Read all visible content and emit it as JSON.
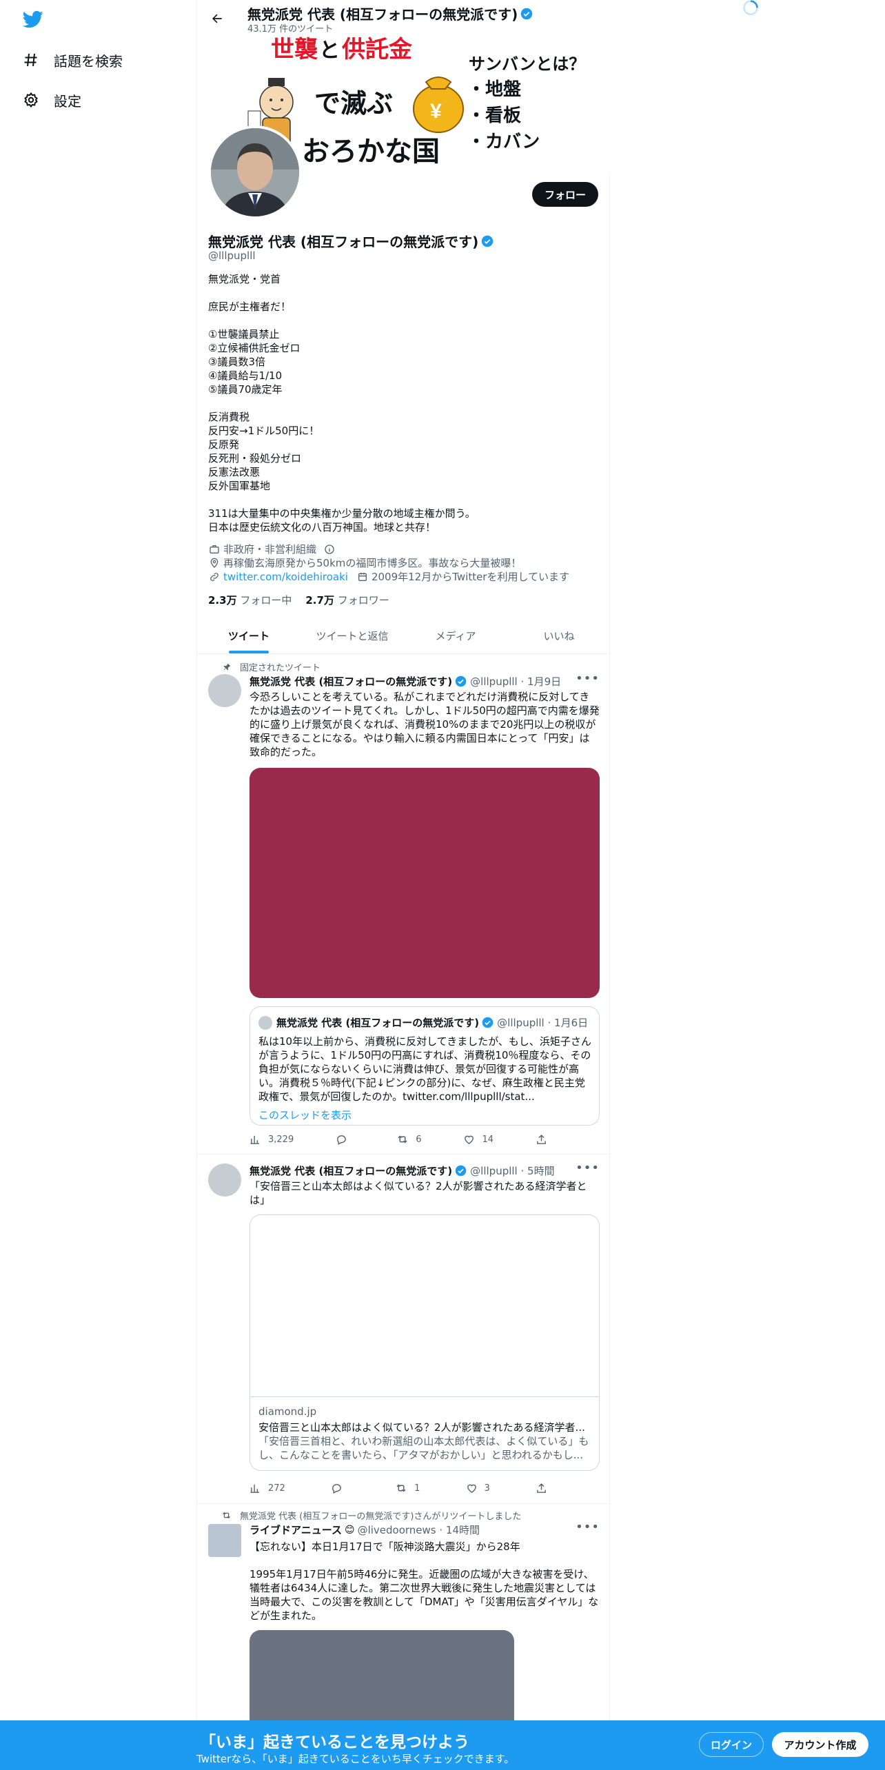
{
  "nav": {
    "items": [
      {
        "label": "話題を検索",
        "icon": "hashtag-icon"
      },
      {
        "label": "設定",
        "icon": "gear-icon"
      }
    ]
  },
  "header": {
    "title": "無党派党 代表 (相互フォローの無党派です)",
    "subtitle": "43.1万 件のツイート"
  },
  "banner": {
    "line1a": "世襲",
    "line1b": "と",
    "line1c": "供託金",
    "line2": "で滅ぶ",
    "line3": "おろかな国",
    "right_title": "サンバンとは？",
    "right_items": [
      "・地盤",
      "・看板",
      "・カバン"
    ],
    "yen": "¥"
  },
  "profile": {
    "follow_label": "フォロー",
    "name": "無党派党 代表 (相互フォローの無党派です)",
    "handle": "@lllpuplll",
    "bio": [
      "無党派党・党首",
      "",
      "庶民が主権者だ！",
      "",
      "①世襲議員禁止",
      "②立候補供託金ゼロ",
      "③議員数3倍",
      "④議員給与1/10",
      "⑤議員70歳定年",
      "",
      "反消費税",
      "反円安→1ドル50円に！",
      "反原発",
      "反死刑・殺処分ゼロ",
      "反憲法改悪",
      "反外国軍基地",
      "",
      "311は大量集中の中央集権か少量分散の地域主権か問う。",
      "日本は歴史伝統文化の八百万神国。地球と共存！"
    ],
    "category": "非政府・非営利組織",
    "location": "再稼働玄海原発から50kmの福岡市博多区。事故なら大量被曝！",
    "website": "twitter.com/koidehiroaki",
    "joined": "2009年12月からTwitterを利用しています",
    "following_count": "2.3万",
    "following_label": "フォロー中",
    "followers_count": "2.7万",
    "followers_label": "フォロワー"
  },
  "tabs": [
    "ツイート",
    "ツイートと返信",
    "メディア",
    "いいね"
  ],
  "tweets": [
    {
      "context": "固定されたツイート",
      "name": "無党派党 代表 (相互フォローの無党派です)",
      "handle": "@lllpuplll",
      "time": "1月9日",
      "text": "今恐ろしいことを考えている。私がこれまでどれだけ消費税に反対してきたかは過去のツイート見てくれ。しかし、1ドル50円の超円高で内需を爆発的に盛り上げ景気が良くなれば、消費税10%のままで20兆円以上の税収が確保できることになる。やはり輸入に頼る内需国日本にとって「円安」は致命的だった。",
      "media_color": "#992a4b",
      "quote": {
        "name": "無党派党 代表 (相互フォローの無党派です)",
        "handle": "@lllpuplll",
        "time": "1月6日",
        "text": "私は10年以上前から、消費税に反対してきましたが、もし、浜矩子さんが言うように、1ドル50円の円高にすれば、消費税10％程度なら、その負担が気にならないくらいに消費は伸び、景気が回復する可能性が高い。消費税５％時代(下記↓ピンクの部分)に、なぜ、麻生政権と民主党政権で、景気が回復したのか。twitter.com/lllpuplll/stat...",
        "thread": "このスレッドを表示"
      },
      "views": "3,229",
      "replies": "",
      "retweets": "6",
      "likes": "14"
    },
    {
      "context": "",
      "name": "無党派党 代表 (相互フォローの無党派です)",
      "handle": "@lllpuplll",
      "time": "5時間",
      "text": "「安倍晋三と山本太郎はよく似ている？2人が影響されたある経済学者とは」",
      "card": {
        "domain": "diamond.jp",
        "title": "安倍晋三と山本太郎はよく似ている？2人が影響されたある経済学者...",
        "desc": "「安倍晋三首相と、れいわ新選組の山本太郎代表は、よく似ている」もし、こんなことを書いたら、「アタマがおかしい」と思われるかもし..."
      },
      "views": "272",
      "replies": "",
      "retweets": "1",
      "likes": "3"
    },
    {
      "context": "無党派党 代表 (相互フォローの無党派です)さんがリツイートしました",
      "name": "ライブドアニュース",
      "badge": "😊",
      "handle": "@livedoornews",
      "time": "14時間",
      "text_line1": "【忘れない】本日1月17日で「阪神淡路大震災」から28年",
      "text_line2": "1995年1月17日午前5時46分に発生。近畿圏の広域が大きな被害を受け、犠牲者は6434人に達した。第二次世界大戦後に発生した地震災害としては当時最大で、この災害を教訓として「DMAT」や「災害用伝言ダイヤル」などが生まれた。",
      "media_color": "#6b7280"
    }
  ],
  "bottom": {
    "title": "「いま」起きていることを見つけよう",
    "subtitle": "Twitterなら、「いま」起きていることをいち早くチェックできます。",
    "login": "ログイン",
    "signup": "アカウント作成"
  }
}
